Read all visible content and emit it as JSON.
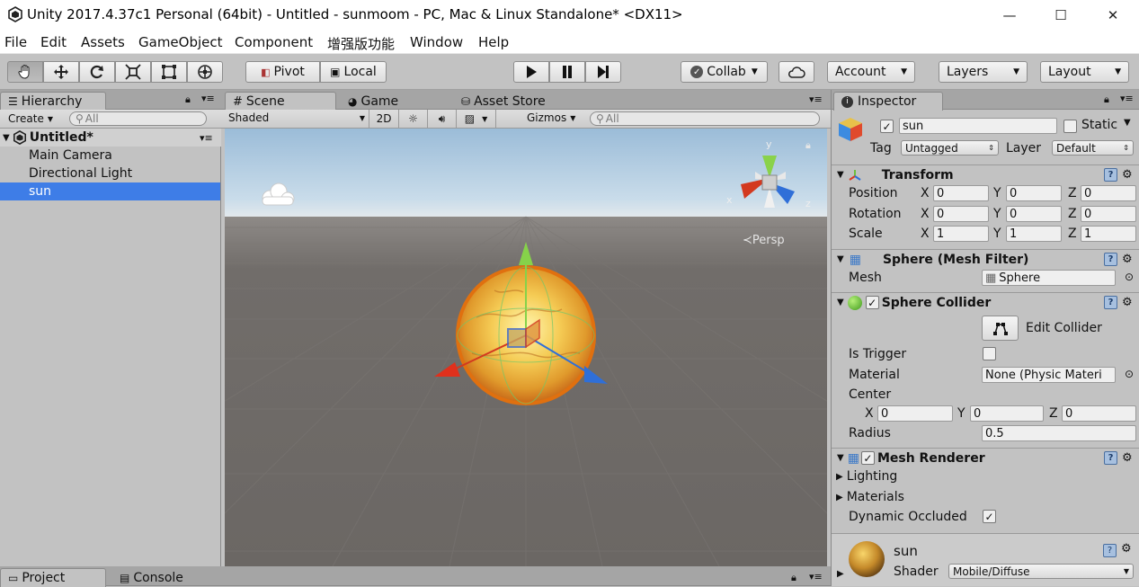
{
  "window": {
    "title": "Unity 2017.4.37c1 Personal (64bit) - Untitled - sunmoom - PC, Mac & Linux Standalone* <DX11>",
    "minimize": "—",
    "maximize": "☐",
    "close": "✕"
  },
  "menu": [
    "File",
    "Edit",
    "Assets",
    "GameObject",
    "Component",
    "增强版功能",
    "Window",
    "Help"
  ],
  "toolbar": {
    "pivot": "Pivot",
    "local": "Local",
    "collab": "Collab",
    "account": "Account",
    "layers": "Layers",
    "layout": "Layout"
  },
  "hierarchy": {
    "tab": "Hierarchy",
    "create": "Create",
    "search_placeholder": "All",
    "scene": "Untitled*",
    "items": [
      "Main Camera",
      "Directional Light",
      "sun"
    ],
    "selected_index": 2
  },
  "scene": {
    "tabs": [
      "Scene",
      "Game",
      "Asset Store"
    ],
    "shading": "Shaded",
    "mode_2d": "2D",
    "gizmos": "Gizmos",
    "search_placeholder": "All",
    "persp": "Persp",
    "axis_y": "y",
    "axis_x": "x",
    "axis_z": "z"
  },
  "inspector": {
    "tab": "Inspector",
    "object_name": "sun",
    "static_label": "Static",
    "tag_label": "Tag",
    "tag_value": "Untagged",
    "layer_label": "Layer",
    "layer_value": "Default",
    "transform": {
      "title": "Transform",
      "position_label": "Position",
      "rotation_label": "Rotation",
      "scale_label": "Scale",
      "position": [
        "0",
        "0",
        "0"
      ],
      "rotation": [
        "0",
        "0",
        "0"
      ],
      "scale": [
        "1",
        "1",
        "1"
      ],
      "axes": [
        "X",
        "Y",
        "Z"
      ]
    },
    "mesh_filter": {
      "title": "Sphere (Mesh Filter)",
      "mesh_label": "Mesh",
      "mesh_value": "Sphere"
    },
    "sphere_collider": {
      "title": "Sphere Collider",
      "edit_collider": "Edit Collider",
      "is_trigger_label": "Is Trigger",
      "material_label": "Material",
      "material_value": "None (Physic Materi",
      "center_label": "Center",
      "center": [
        "0",
        "0",
        "0"
      ],
      "radius_label": "Radius",
      "radius_value": "0.5"
    },
    "mesh_renderer": {
      "title": "Mesh Renderer",
      "lighting": "Lighting",
      "materials": "Materials",
      "dynamic_occluded": "Dynamic Occluded"
    },
    "material": {
      "name": "sun",
      "shader_label": "Shader",
      "shader_value": "Mobile/Diffuse"
    }
  },
  "bottom": {
    "project_tab": "Project",
    "console_tab": "Console"
  },
  "colors": {
    "selection": "#3e7de7",
    "panel_bg": "#c2c2c2",
    "scene_ground": "#6f6b68",
    "sky": "#b9d3e8"
  },
  "icons": [
    "unity-logo",
    "hand-tool-icon",
    "move-tool-icon",
    "rotate-tool-icon",
    "scale-tool-icon",
    "rect-tool-icon",
    "transform-tool-icon",
    "play-icon",
    "pause-icon",
    "step-icon",
    "cloud-icon",
    "lock-icon",
    "gear-icon",
    "help-icon",
    "cube-icon"
  ]
}
